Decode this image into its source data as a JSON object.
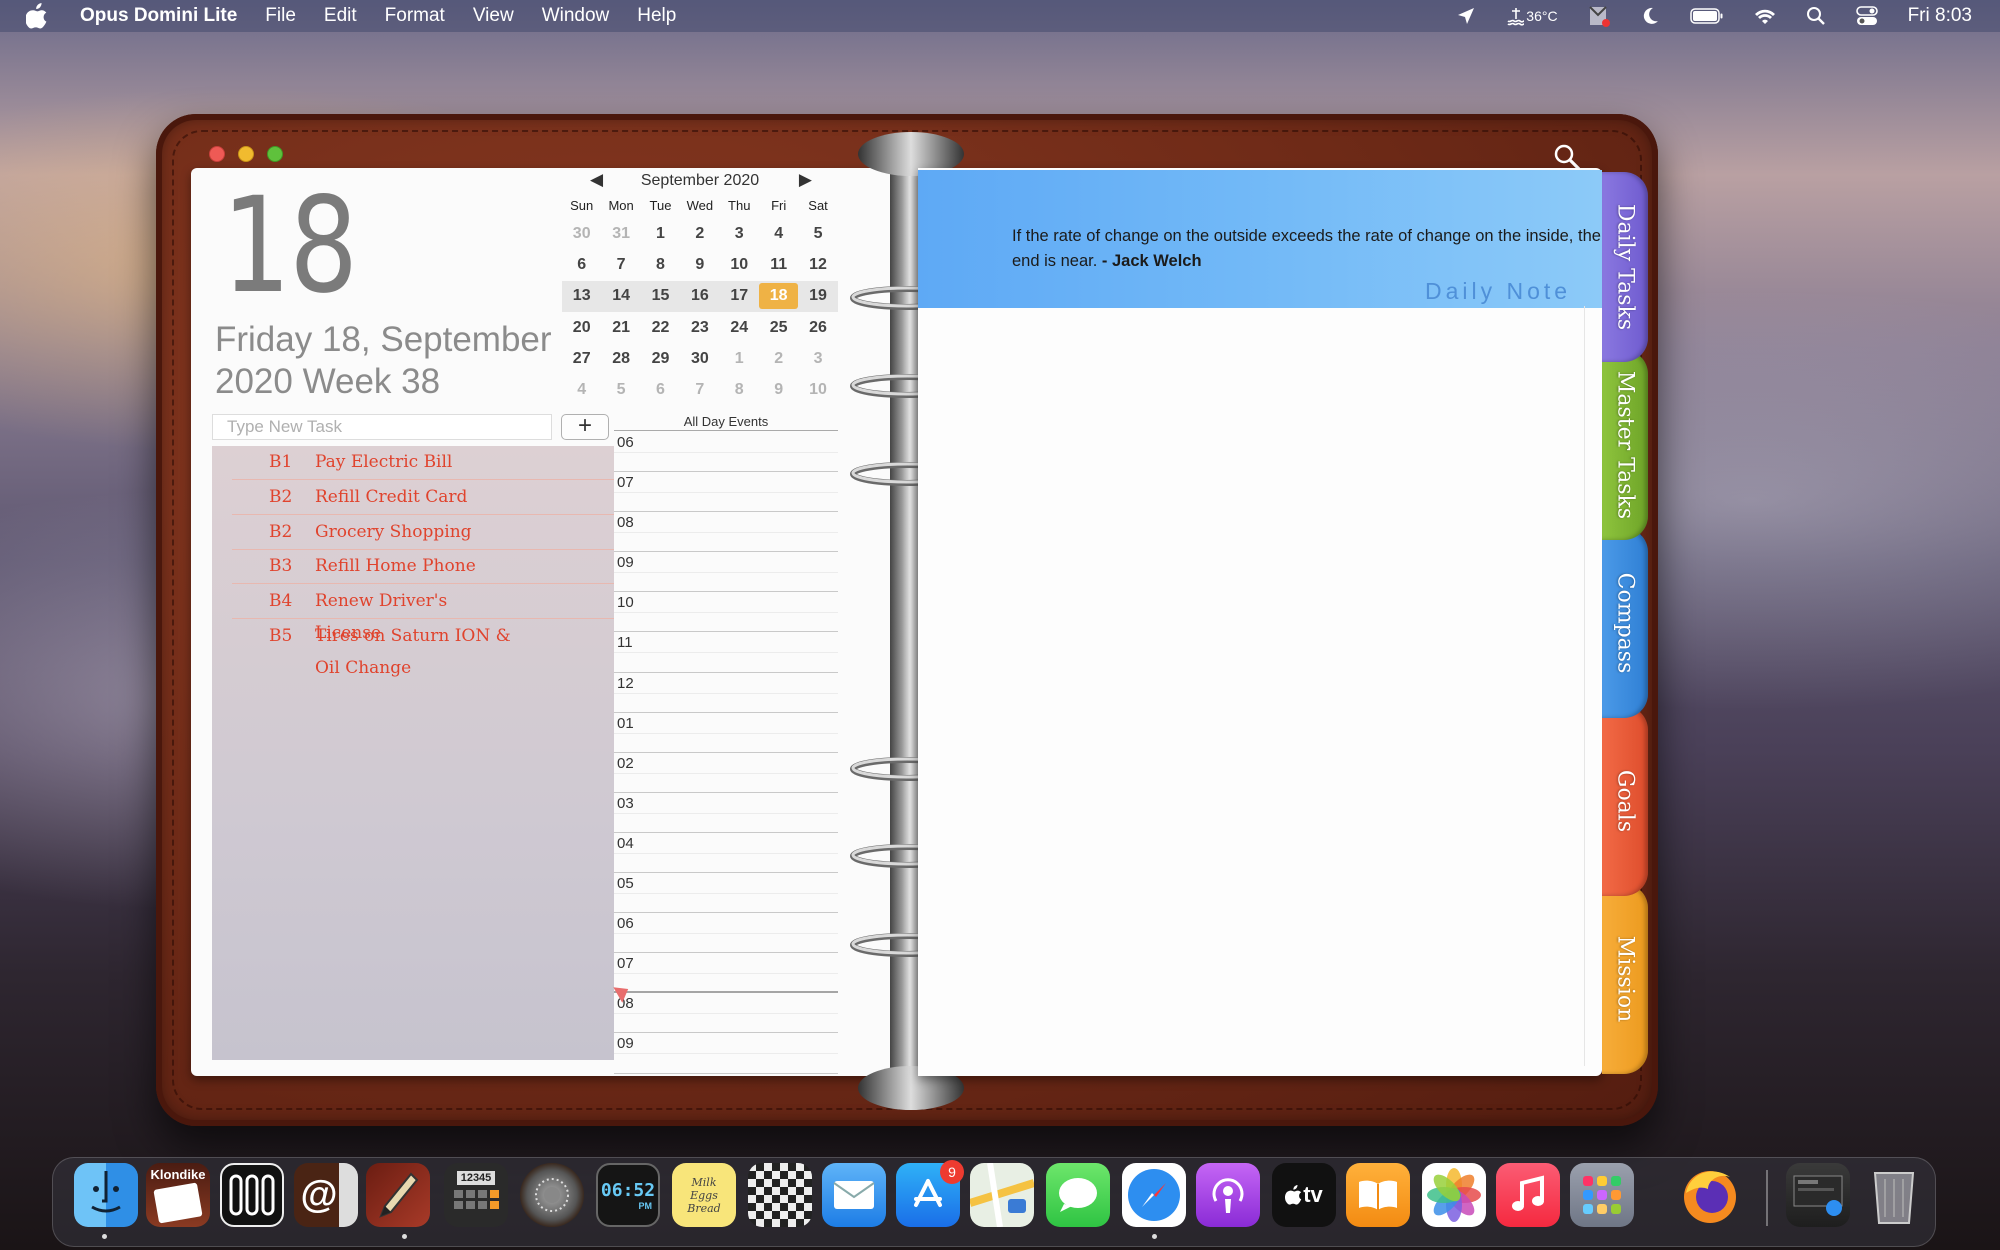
{
  "menubar": {
    "app_name": "Opus Domini Lite",
    "menus": [
      "File",
      "Edit",
      "Format",
      "View",
      "Window",
      "Help"
    ],
    "temperature": "36°C",
    "clock": "Fri 8:03"
  },
  "planner": {
    "day_number": "18",
    "date_line1": "Friday 18, September",
    "date_line2": "2020 Week 38",
    "calendar": {
      "month_label": "September 2020",
      "prev": "◀",
      "next": "▶",
      "weekdays": [
        "Sun",
        "Mon",
        "Tue",
        "Wed",
        "Thu",
        "Fri",
        "Sat"
      ],
      "weeks": [
        [
          "30",
          "31",
          "1",
          "2",
          "3",
          "4",
          "5"
        ],
        [
          "6",
          "7",
          "8",
          "9",
          "10",
          "11",
          "12"
        ],
        [
          "13",
          "14",
          "15",
          "16",
          "17",
          "18",
          "19"
        ],
        [
          "20",
          "21",
          "22",
          "23",
          "24",
          "25",
          "26"
        ],
        [
          "27",
          "28",
          "29",
          "30",
          "1",
          "2",
          "3"
        ],
        [
          "4",
          "5",
          "6",
          "7",
          "8",
          "9",
          "10"
        ]
      ]
    },
    "task_input_placeholder": "Type New Task",
    "add_button": "+",
    "tasks": [
      {
        "priority": "B1",
        "text": "Pay Electric Bill"
      },
      {
        "priority": "B2",
        "text": "Refill Credit Card"
      },
      {
        "priority": "B2",
        "text": "Grocery Shopping"
      },
      {
        "priority": "B3",
        "text": "Refill Home Phone"
      },
      {
        "priority": "B4",
        "text": "Renew Driver's License"
      },
      {
        "priority": "B5",
        "text": "Tires on Saturn ION & Oil Change"
      }
    ],
    "all_day_label": "All Day Events",
    "hours": [
      "06",
      "07",
      "08",
      "09",
      "10",
      "11",
      "12",
      "01",
      "02",
      "03",
      "04",
      "05",
      "06",
      "07",
      "08",
      "09"
    ],
    "quote_text": "If the rate of change on the outside exceeds the rate of change on the inside, the end is near.",
    "quote_author": "- Jack Welch",
    "note_title": "Daily Note",
    "tabs": [
      "Daily Tasks",
      "Master Tasks",
      "Compass",
      "Goals",
      "Mission"
    ]
  },
  "dock": {
    "klondike_label": "Klondike",
    "counter_label": "12345",
    "clock_label": "06:52",
    "clock_suffix": "PM",
    "notes_label": "Milk Eggs Bread",
    "appletv_label": "tv",
    "appstore_badge": "9"
  }
}
